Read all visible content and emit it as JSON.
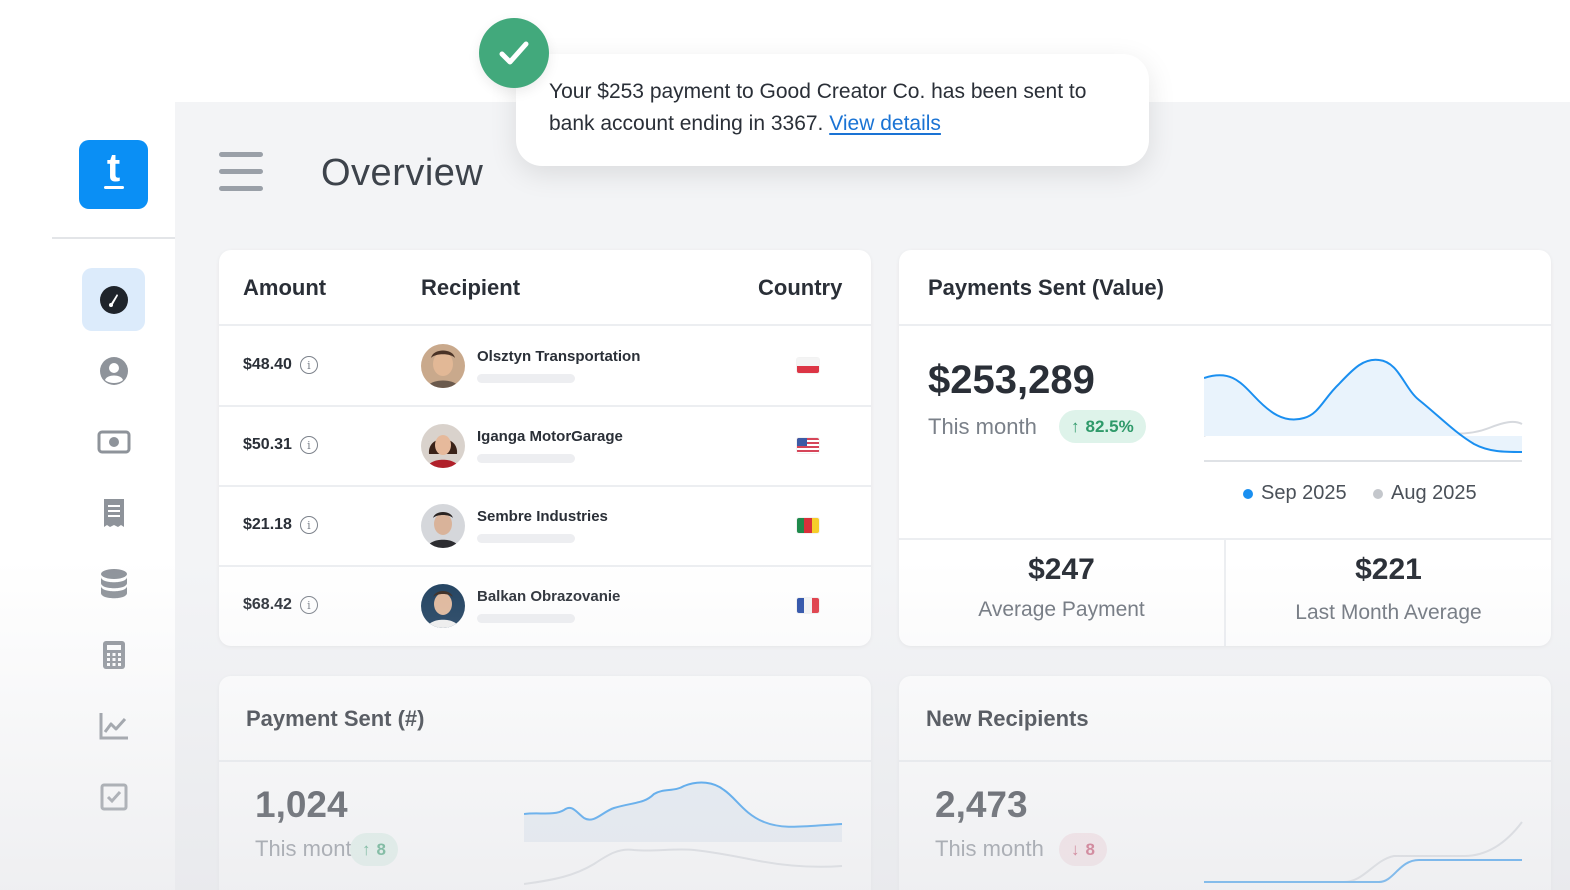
{
  "app": {
    "logo_letter": "t",
    "page_title": "Overview",
    "accent_color": "#0a8ff5"
  },
  "sidebar": {
    "items": [
      {
        "icon": "dashboard-icon",
        "active": true
      },
      {
        "icon": "user-icon",
        "active": false
      },
      {
        "icon": "money-icon",
        "active": false
      },
      {
        "icon": "receipt-icon",
        "active": false
      },
      {
        "icon": "database-icon",
        "active": false
      },
      {
        "icon": "calculator-icon",
        "active": false
      },
      {
        "icon": "chart-icon",
        "active": false
      },
      {
        "icon": "checkbox-icon",
        "active": false
      }
    ]
  },
  "toast": {
    "message": "Your $253 payment to Good Creator Co. has been sent to bank account ending in 3367.",
    "link_text": "View details",
    "status_color": "#42a97c"
  },
  "recipients_table": {
    "columns": [
      "Amount",
      "Recipient",
      "Country"
    ],
    "rows": [
      {
        "amount": "$48.40",
        "recipient": "Olsztyn Transportation",
        "country_flag": "poland-flag-icon"
      },
      {
        "amount": "$50.31",
        "recipient": "Iganga MotorGarage",
        "country_flag": "usa-flag-icon"
      },
      {
        "amount": "$21.18",
        "recipient": "Sembre Industries",
        "country_flag": "cameroon-flag-icon"
      },
      {
        "amount": "$68.42",
        "recipient": "Balkan Obrazovanie",
        "country_flag": "france-flag-icon"
      }
    ]
  },
  "payments_value": {
    "title": "Payments Sent (Value)",
    "value": "$253,289",
    "period_label": "This month",
    "change": "82.5%",
    "change_direction": "up",
    "legend": [
      {
        "label": "Sep 2025",
        "color": "#1a8ff0"
      },
      {
        "label": "Aug 2025",
        "color": "#c4c7cc"
      }
    ],
    "average_payment": {
      "value": "$247",
      "label": "Average Payment"
    },
    "last_month_average": {
      "value": "$221",
      "label": "Last Month Average"
    }
  },
  "payment_count": {
    "title": "Payment Sent (#)",
    "value": "1,024",
    "period_label": "This month",
    "change": "8",
    "change_direction": "up"
  },
  "new_recipients": {
    "title": "New Recipients",
    "value": "2,473",
    "period_label": "This month",
    "change": "8",
    "change_direction": "down"
  }
}
